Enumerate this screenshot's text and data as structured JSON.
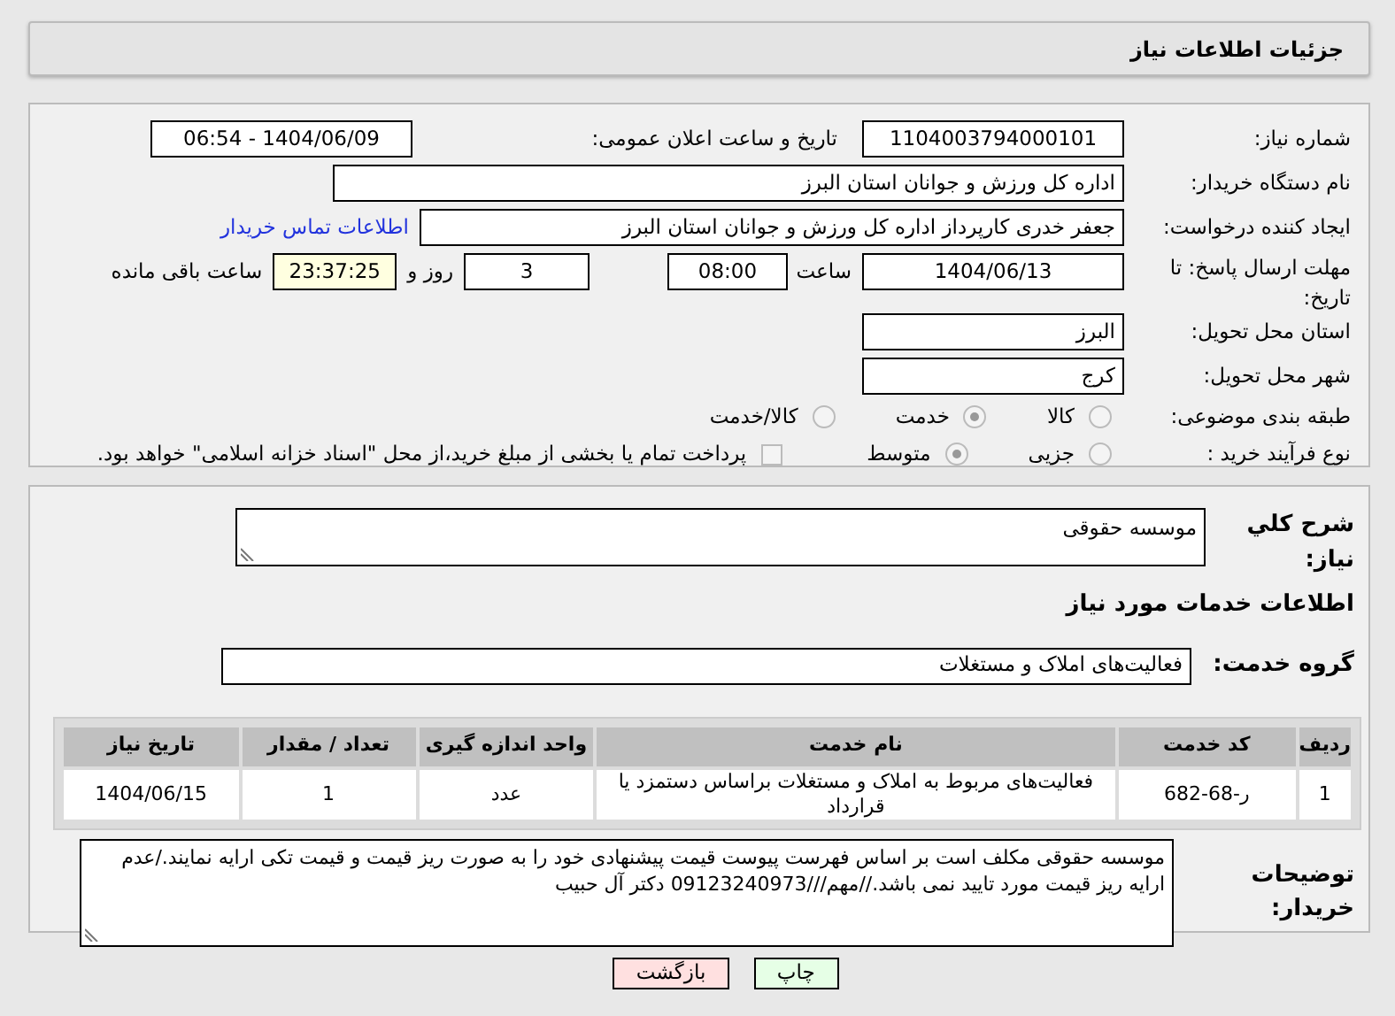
{
  "header": {
    "title": "جزئیات اطلاعات نیاز"
  },
  "need_number": {
    "label": "شماره نیاز:",
    "value": "1104003794000101"
  },
  "announce": {
    "label": "تاریخ و ساعت اعلان عمومی:",
    "value": "1404/06/09 - 06:54"
  },
  "buyer_org": {
    "label": "نام دستگاه خریدار:",
    "value": "اداره کل ورزش و جوانان استان البرز"
  },
  "creator": {
    "label": "ایجاد کننده درخواست:",
    "value": "جعفر خدری کارپرداز اداره کل ورزش و جوانان استان البرز",
    "link": "اطلاعات تماس خریدار"
  },
  "deadline": {
    "label": "مهلت ارسال پاسخ: تا تاریخ:",
    "date": "1404/06/13",
    "time_label": "ساعت",
    "time": "08:00",
    "days": "3",
    "days_label": "روز و",
    "remaining": "23:37:25",
    "remaining_label": "ساعت باقی مانده"
  },
  "province": {
    "label": "استان محل تحویل:",
    "value": "البرز"
  },
  "city": {
    "label": "شهر محل تحویل:",
    "value": "کرج"
  },
  "category": {
    "label": "طبقه بندی موضوعی:",
    "options": [
      {
        "label": "کالا",
        "selected": false
      },
      {
        "label": "خدمت",
        "selected": true
      },
      {
        "label": "کالا/خدمت",
        "selected": false
      }
    ]
  },
  "process": {
    "label": "نوع فرآیند خرید :",
    "options": [
      {
        "label": "جزیی",
        "selected": false
      },
      {
        "label": "متوسط",
        "selected": true
      }
    ],
    "payment": {
      "checked": false,
      "text": "پرداخت تمام یا بخشی از مبلغ خرید،از محل \"اسناد خزانه اسلامی\" خواهد بود."
    }
  },
  "description": {
    "label": "شرح کلي نياز:",
    "value": "موسسه حقوقی"
  },
  "services_title": "اطلاعات خدمات مورد نیاز",
  "service_group": {
    "label": "گروه خدمت:",
    "value": "فعالیت‌های  املاک و مستغلات"
  },
  "table": {
    "columns": [
      "ردیف",
      "کد خدمت",
      "نام خدمت",
      "واحد اندازه گیری",
      "تعداد / مقدار",
      "تاریخ نیاز"
    ],
    "rows": [
      [
        "1",
        "ر-68-682",
        "فعالیت‌های مربوط به املاک و مستغلات براساس دستمزد یا قرارداد",
        "عدد",
        "1",
        "1404/06/15"
      ]
    ]
  },
  "buyer_notes": {
    "label": "توضیحات خریدار:",
    "value": "موسسه حقوقی مکلف است بر اساس فهرست پیوست قیمت پیشنهادی خود را به صورت ریز قیمت و قیمت تکی ارایه نمایند./عدم ارایه ریز قیمت مورد تایید نمی باشد.//مهم///09123240973  دکتر  آل حبیب"
  },
  "buttons": [
    {
      "label": "چاپ",
      "kind": "print"
    },
    {
      "label": "بازگشت",
      "kind": "back"
    }
  ]
}
